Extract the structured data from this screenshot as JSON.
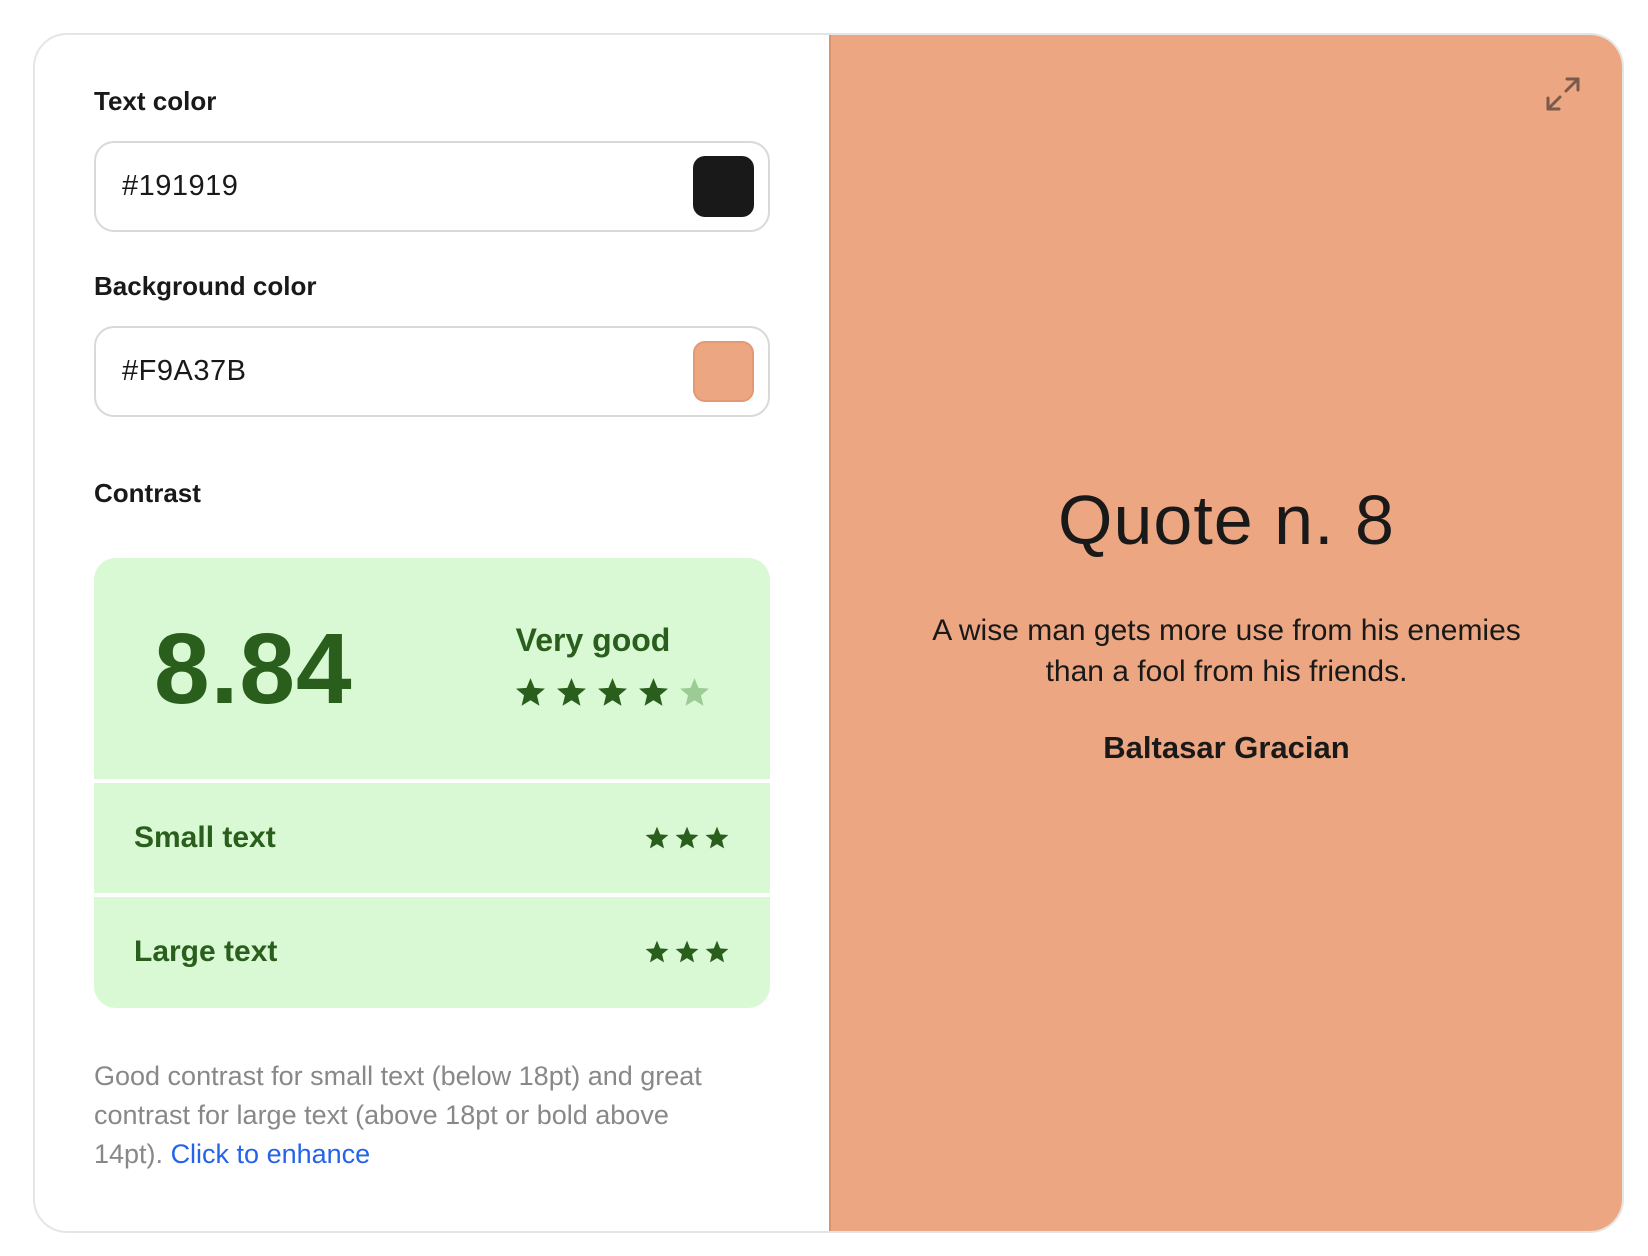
{
  "colors": {
    "text": "#191919",
    "background": "#F9A37B",
    "preview_background": "#ECA682",
    "contrast_bg": "#D9F8D4",
    "contrast_fg": "#2A5E1C",
    "star_dim": "#9DCB95",
    "link": "#2563EB"
  },
  "text_color": {
    "label": "Text color",
    "value": "#191919"
  },
  "background_color": {
    "label": "Background color",
    "value": "#F9A37B"
  },
  "contrast": {
    "label": "Contrast",
    "score": "8.84",
    "rating_label": "Very good",
    "rating_stars": 4,
    "rating_stars_max": 5,
    "small_text": {
      "label": "Small text",
      "stars": 3
    },
    "large_text": {
      "label": "Large text",
      "stars": 3
    }
  },
  "description": {
    "text": "Good contrast for small text (below 18pt) and great contrast for large text (above 18pt or bold above 14pt).",
    "link_label": "Click to enhance"
  },
  "preview": {
    "expand_icon": "expand-icon",
    "title": "Quote n. 8",
    "quote": "A wise man gets more use from his enemies than a fool from his friends.",
    "author": "Baltasar Gracian"
  }
}
